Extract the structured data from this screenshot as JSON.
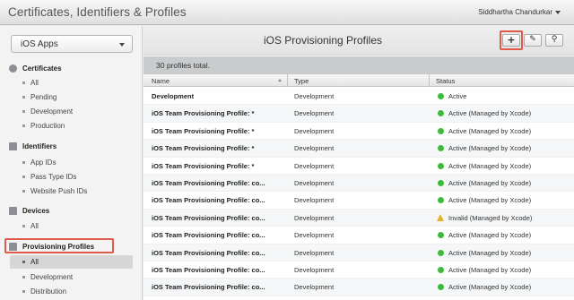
{
  "header": {
    "title": "Certificates, Identifiers & Profiles",
    "user": "Siddhartha Chandurkar"
  },
  "sidebar": {
    "platform": "iOS Apps",
    "sections": [
      {
        "label": "Certificates",
        "icon": "certificate-icon",
        "items": [
          "All",
          "Pending",
          "Development",
          "Production"
        ]
      },
      {
        "label": "Identifiers",
        "icon": "id-icon",
        "items": [
          "App IDs",
          "Pass Type IDs",
          "Website Push IDs"
        ]
      },
      {
        "label": "Devices",
        "icon": "device-icon",
        "items": [
          "All"
        ]
      },
      {
        "label": "Provisioning Profiles",
        "icon": "profile-icon",
        "items": [
          "All",
          "Development",
          "Distribution"
        ]
      }
    ]
  },
  "main": {
    "title": "iOS Provisioning Profiles",
    "add_glyph": "+",
    "edit_glyph": "✎",
    "search_glyph": "⚲",
    "count_text": "30 profiles total.",
    "columns": [
      "Name",
      "Type",
      "Status"
    ],
    "rows": [
      {
        "name": "Development",
        "type": "Development",
        "status": "Active",
        "state": "ok"
      },
      {
        "name": "iOS Team Provisioning Profile: *",
        "type": "Development",
        "status": "Active (Managed by Xcode)",
        "state": "ok"
      },
      {
        "name": "iOS Team Provisioning Profile: *",
        "type": "Development",
        "status": "Active (Managed by Xcode)",
        "state": "ok"
      },
      {
        "name": "iOS Team Provisioning Profile: *",
        "type": "Development",
        "status": "Active (Managed by Xcode)",
        "state": "ok"
      },
      {
        "name": "iOS Team Provisioning Profile: *",
        "type": "Development",
        "status": "Active (Managed by Xcode)",
        "state": "ok"
      },
      {
        "name": "iOS Team Provisioning Profile: co...",
        "type": "Development",
        "status": "Active (Managed by Xcode)",
        "state": "ok"
      },
      {
        "name": "iOS Team Provisioning Profile: co...",
        "type": "Development",
        "status": "Active (Managed by Xcode)",
        "state": "ok"
      },
      {
        "name": "iOS Team Provisioning Profile: co...",
        "type": "Development",
        "status": "Invalid (Managed by Xcode)",
        "state": "warn"
      },
      {
        "name": "iOS Team Provisioning Profile: co...",
        "type": "Development",
        "status": "Active (Managed by Xcode)",
        "state": "ok"
      },
      {
        "name": "iOS Team Provisioning Profile: co...",
        "type": "Development",
        "status": "Active (Managed by Xcode)",
        "state": "ok"
      },
      {
        "name": "iOS Team Provisioning Profile: co...",
        "type": "Development",
        "status": "Active (Managed by Xcode)",
        "state": "ok"
      },
      {
        "name": "iOS Team Provisioning Profile: co...",
        "type": "Development",
        "status": "Active (Managed by Xcode)",
        "state": "ok"
      }
    ]
  },
  "colors": {
    "active": "#3cbb3a",
    "warning": "#e6b02a",
    "highlight": "#e05a4d"
  }
}
